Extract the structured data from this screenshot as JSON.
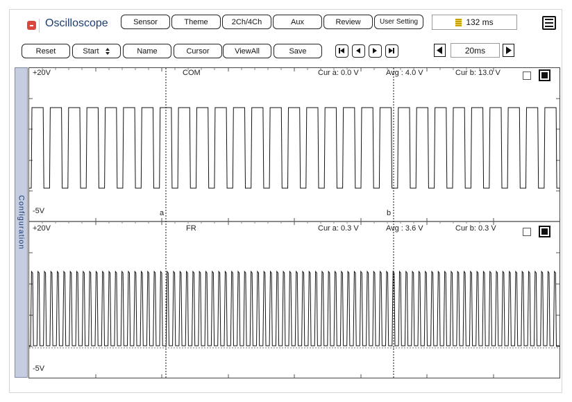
{
  "app": {
    "title": "Oscilloscope"
  },
  "toolbar_top": {
    "buttons": [
      "Sensor",
      "Theme",
      "2Ch/4Ch",
      "Aux",
      "Review",
      "User Setting"
    ],
    "capture_time": "132 ms"
  },
  "toolbar_second": {
    "reset": "Reset",
    "start_select": "Start",
    "name": "Name",
    "cursor": "Cursor",
    "view_all": "ViewAll",
    "save": "Save",
    "time_div": "20ms"
  },
  "sidebar": {
    "label": "Configuration"
  },
  "channels": [
    {
      "name": "COM",
      "top_label": "+20V",
      "bottom_label": "-5V",
      "cur_a": "Cur a: 0.0 V",
      "avg": "Avg : 4.0 V",
      "cur_b": "Cur b: 13.0 V",
      "cursor_a_label": "a",
      "cursor_b_label": "b"
    },
    {
      "name": "FR",
      "top_label": "+20V",
      "bottom_label": "-5V",
      "cur_a": "Cur a: 0.3 V",
      "avg": "Avg : 3.6 V",
      "cur_b": "Cur b: 0.3 V"
    }
  ],
  "colors": {
    "title": "#1b3d72",
    "app_icon": "#d9473e",
    "sidebar": "#c6cde0",
    "trace": "#111111"
  }
}
